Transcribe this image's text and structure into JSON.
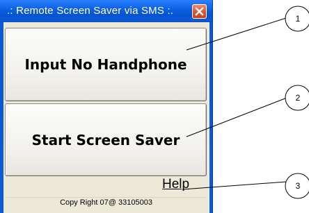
{
  "window": {
    "title": ".: Remote Screen Saver via SMS :.",
    "close_icon": "close-icon"
  },
  "buttons": {
    "input_label": "Input No Handphone",
    "start_label": "Start Screen Saver"
  },
  "help_link": "Help",
  "status_bar": "Copy Right 07@ 33105003",
  "callouts": [
    "1",
    "2",
    "3"
  ],
  "colors": {
    "titlebar": "#0a5fe0",
    "close_button": "#e0532b",
    "client_background": "#ece9d8"
  }
}
